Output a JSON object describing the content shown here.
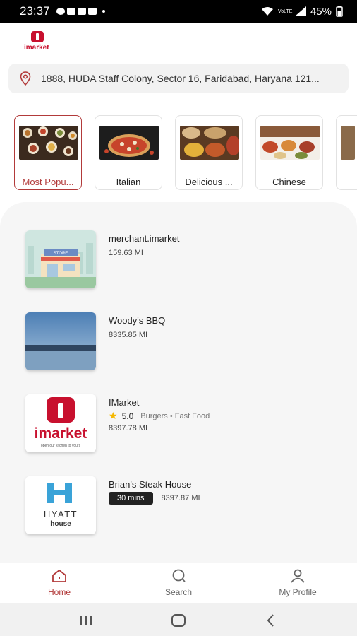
{
  "status_bar": {
    "time": "23:37",
    "network": "VoLTE",
    "battery": "45%"
  },
  "brand": {
    "logo_text": "imarket"
  },
  "address": {
    "text": "1888, HUDA Staff Colony, Sector 16, Faridabad, Haryana 121..."
  },
  "categories": [
    {
      "label": "Most Popu...",
      "active": true
    },
    {
      "label": "Italian",
      "active": false
    },
    {
      "label": "Delicious ...",
      "active": false
    },
    {
      "label": "Chinese",
      "active": false
    }
  ],
  "restaurants": [
    {
      "name": "merchant.imarket",
      "distance": "159.63 MI"
    },
    {
      "name": "Woody's BBQ",
      "distance": "8335.85 MI"
    },
    {
      "name": "IMarket",
      "rating": "5.0",
      "cuisine": "Burgers • Fast Food",
      "distance": "8397.78 MI"
    },
    {
      "name": "Brian's Steak House",
      "delivery_time": "30 mins",
      "distance": "8397.87 MI"
    }
  ],
  "thumb_text": {
    "store_sign": "STORE",
    "imarket_logo": "imarket",
    "imarket_tagline": "open our kitchen to yours",
    "hyatt": "HYATT",
    "hyatt_house": "house"
  },
  "bottom_nav": [
    {
      "label": "Home",
      "icon": "home-icon",
      "active": true
    },
    {
      "label": "Search",
      "icon": "search-icon",
      "active": false
    },
    {
      "label": "My Profile",
      "icon": "profile-icon",
      "active": false
    }
  ],
  "colors": {
    "accent": "#b23a3a",
    "brand_red": "#c8102e",
    "star": "#f5b800"
  }
}
